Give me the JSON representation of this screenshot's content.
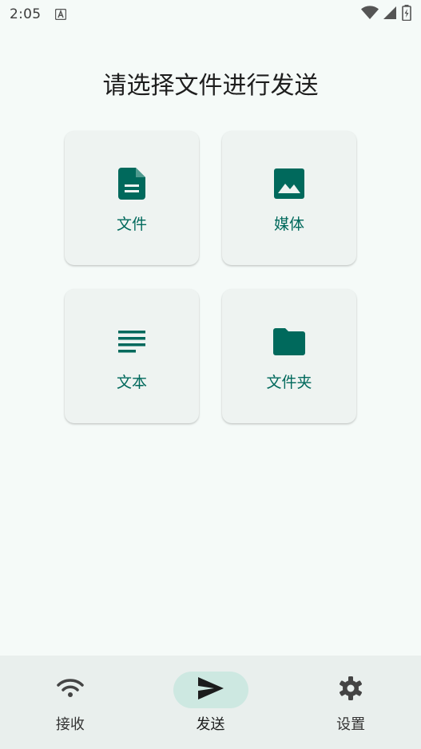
{
  "status_bar": {
    "time": "2:05",
    "notification_icon": "a-letter-icon",
    "icons": [
      "wifi-icon",
      "cell-signal-icon",
      "battery-charging-icon"
    ]
  },
  "title": "请选择文件进行发送",
  "options": [
    {
      "label": "文件",
      "icon": "file-document-icon"
    },
    {
      "label": "媒体",
      "icon": "image-icon"
    },
    {
      "label": "文本",
      "icon": "text-lines-icon"
    },
    {
      "label": "文件夹",
      "icon": "folder-icon"
    }
  ],
  "bottom_nav": {
    "active": "send",
    "items": [
      {
        "label": "接收",
        "icon": "wifi-icon"
      },
      {
        "label": "发送",
        "icon": "send-icon"
      },
      {
        "label": "设置",
        "icon": "gear-icon"
      }
    ]
  },
  "colors": {
    "accent": "#00695c",
    "background": "#f5faf8",
    "card": "#eef3f1",
    "nav_background": "#e9efed",
    "nav_active_pill": "#cde8e1"
  }
}
